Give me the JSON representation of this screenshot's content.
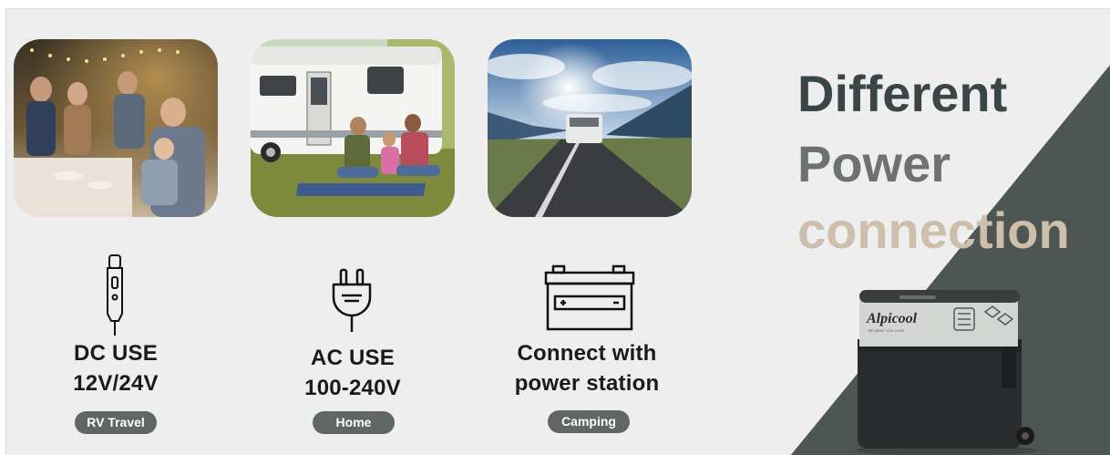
{
  "headline": {
    "line1": "Different",
    "line2": "Power",
    "line3": "connection"
  },
  "uses": [
    {
      "title_line1": "DC USE",
      "title_line2": "12V/24V",
      "tag": "RV Travel",
      "icon": "car-plug-icon"
    },
    {
      "title_line1": "AC USE",
      "title_line2": "100-240V",
      "tag": "Home",
      "icon": "ac-plug-icon"
    },
    {
      "title_line1": "Connect with",
      "title_line2": "power station",
      "tag": "Camping",
      "icon": "battery-icon"
    }
  ],
  "product": {
    "brand": "Alpicool",
    "tagline": "BE WHAT YOU LOVE"
  },
  "colors": {
    "background": "#eeeeee",
    "dark_panel": "#4e5653",
    "pill": "#5f6663",
    "headline_1": "#3a4546",
    "headline_2": "#6d716f",
    "headline_3": "#cdbfac"
  }
}
